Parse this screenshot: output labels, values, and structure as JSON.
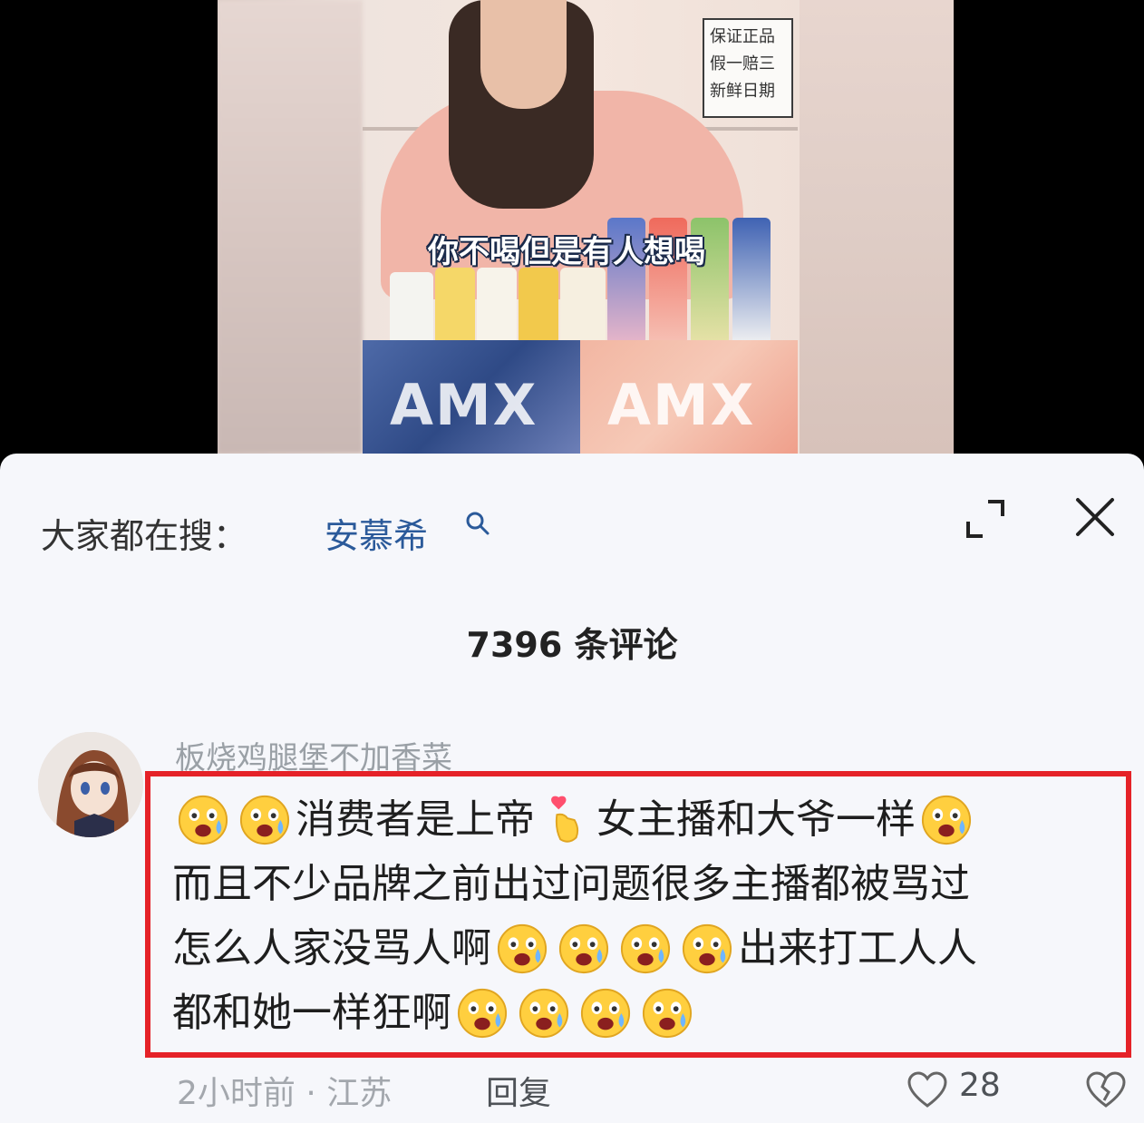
{
  "video": {
    "subtitle": "你不喝但是有人想喝",
    "sign_lines": [
      "保证正品",
      "假一赔三",
      "新鲜日期"
    ],
    "brand_left": "AMX",
    "brand_right": "AMX"
  },
  "panel": {
    "search_prefix": "大家都在搜：",
    "search_term": "安慕希",
    "comment_count": "7396 条评论"
  },
  "comment": {
    "username": "板烧鸡腿堡不加香菜",
    "lines": [
      {
        "segments": [
          "",
          "",
          "消费者是上帝",
          " 女主播和大爷一样",
          ""
        ]
      },
      {
        "segments": [
          "而且不少品牌之前出过问题很多主播都被骂过"
        ]
      },
      {
        "segments": [
          "怎么人家没骂人啊",
          "",
          "",
          "",
          "出来打工人人"
        ]
      },
      {
        "segments": [
          "都和她一样狂啊",
          "",
          "",
          ""
        ]
      }
    ],
    "time_location": "2小时前 · 江苏",
    "reply_label": "回复",
    "like_count": "28"
  },
  "icons": {
    "emoji": "crying-scared-emoji",
    "finger_heart": "finger-heart-emoji",
    "search": "search-icon",
    "expand": "expand-icon",
    "close": "close-icon",
    "like": "heart-icon",
    "dislike": "broken-heart-icon"
  },
  "colors": {
    "highlight_border": "#e52228",
    "search_term": "#2b5a9a",
    "panel_bg": "#f6f7fb"
  }
}
